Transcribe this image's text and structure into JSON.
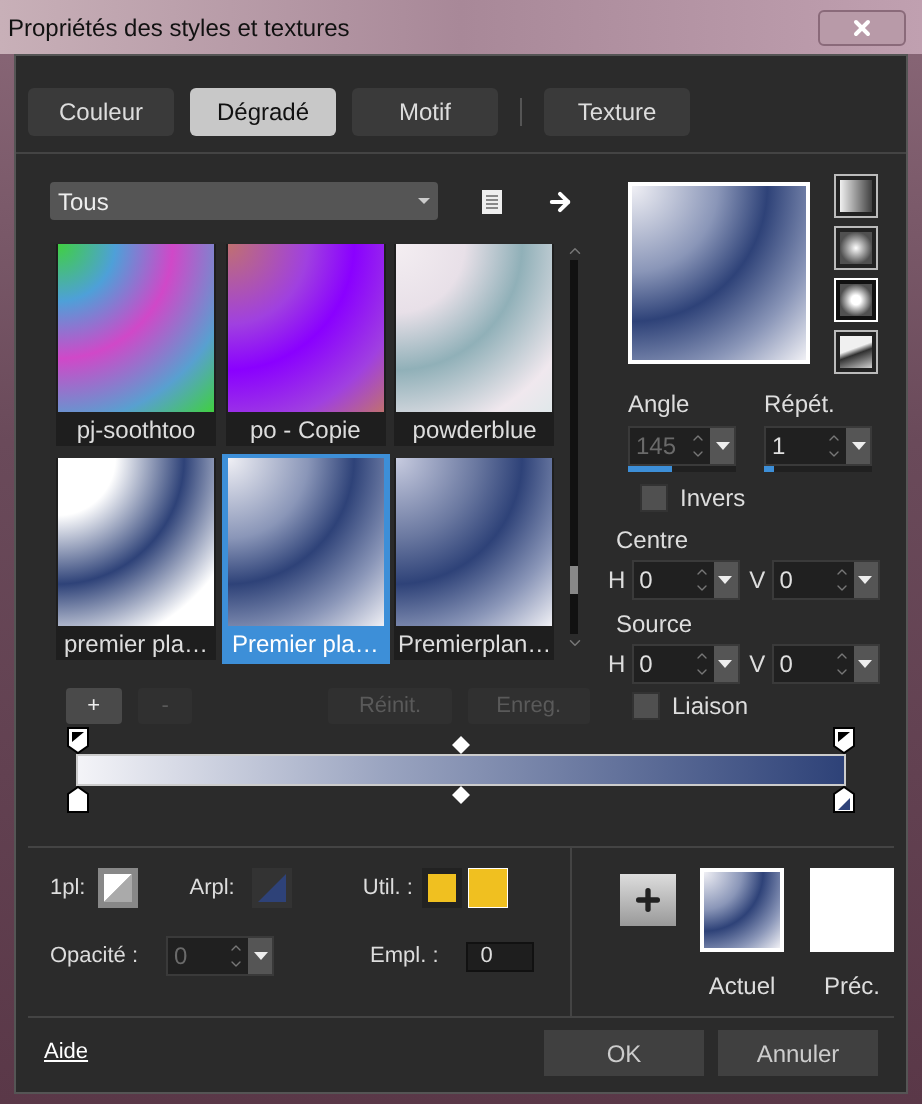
{
  "window": {
    "title": "Propriétés des styles et textures"
  },
  "tabs": [
    {
      "label": "Couleur",
      "selected": false
    },
    {
      "label": "Dégradé",
      "selected": true
    },
    {
      "label": "Motif",
      "selected": false
    },
    {
      "label": "Texture",
      "selected": false
    }
  ],
  "library": {
    "category": "Tous",
    "items": [
      {
        "label": "pj-soothtoo",
        "selected": false
      },
      {
        "label": "po - Copie",
        "selected": false
      },
      {
        "label": "powderblue",
        "selected": false
      },
      {
        "label": "premier pla…",
        "selected": false
      },
      {
        "label": "Premier pla…",
        "selected": true
      },
      {
        "label": "Premierplan…",
        "selected": false
      }
    ],
    "buttons": [
      {
        "label": "+",
        "disabled": false
      },
      {
        "label": "-",
        "disabled": true
      },
      {
        "label": "Réinit.",
        "disabled": true
      },
      {
        "label": "Enreg.",
        "disabled": true
      }
    ]
  },
  "style": {
    "types": [
      {
        "selected": false
      },
      {
        "selected": false
      },
      {
        "selected": true
      },
      {
        "selected": false
      }
    ],
    "angle": {
      "label": "Angle",
      "value": "145",
      "disabled": true,
      "level": 0.4
    },
    "repeat": {
      "label": "Répét.",
      "value": "1",
      "disabled": false,
      "level": 0.1
    },
    "invert": {
      "label": "Invers",
      "checked": false
    },
    "centre": {
      "label": "Centre",
      "h_label": "H",
      "h": "0",
      "v_label": "V",
      "v": "0"
    },
    "source": {
      "label": "Source",
      "h_label": "H",
      "h": "0",
      "v_label": "V",
      "v": "0"
    },
    "link": {
      "label": "Liaison",
      "checked": false
    }
  },
  "stops": {
    "foreground_label": "1pl:",
    "background_label": "Arpl:",
    "user_label": "Util. :",
    "opacity_label": "Opacité :",
    "opacity": {
      "value": "0",
      "disabled": true
    },
    "location_label": "Empl. :",
    "location": "0"
  },
  "compare": {
    "current": "Actuel",
    "previous": "Préc."
  },
  "footer": {
    "help": "Aide",
    "ok": "OK",
    "cancel": "Annuler"
  }
}
